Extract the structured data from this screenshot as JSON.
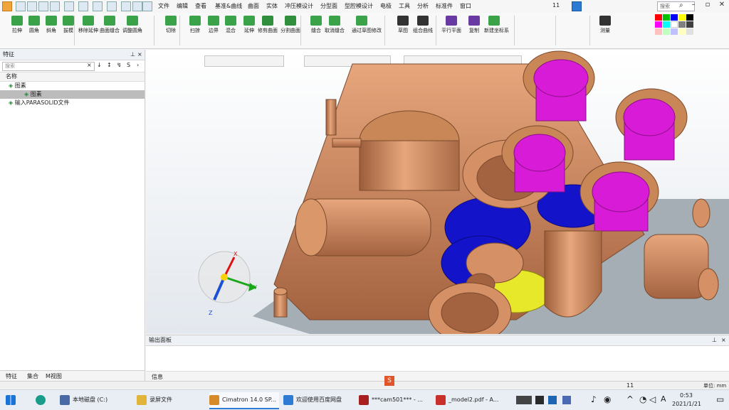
{
  "titlebar": {
    "menu": [
      "文件",
      "编辑",
      "查看",
      "基准&曲线",
      "曲面",
      "实体",
      "冲压模设计",
      "分型面",
      "型腔模设计",
      "电极",
      "工具",
      "分析",
      "标准件",
      "窗口"
    ],
    "page_indicator": "11",
    "search_placeholder": "搜索"
  },
  "ribbon": {
    "buttons": [
      {
        "label": "拉伸",
        "color": "#3aa34a"
      },
      {
        "label": "圆角",
        "color": "#3aa34a"
      },
      {
        "label": "斜角",
        "color": "#3aa34a"
      },
      {
        "label": "拔模",
        "color": "#3aa34a"
      },
      {
        "label": "移除延伸",
        "color": "#3aa34a"
      },
      {
        "label": "曲面缝合",
        "color": "#3aa34a"
      },
      {
        "label": "调整圆角",
        "color": "#3aa34a"
      },
      {
        "label": "切除",
        "color": "#3aa34a"
      },
      {
        "label": "扫掠",
        "color": "#3aa34a"
      },
      {
        "label": "边界",
        "color": "#3aa34a"
      },
      {
        "label": "混合",
        "color": "#3aa34a"
      },
      {
        "label": "延伸",
        "color": "#3aa34a"
      },
      {
        "label": "修剪曲面",
        "color": "#2f8f3c"
      },
      {
        "label": "分割曲面",
        "color": "#2f8f3c"
      },
      {
        "label": "缝合",
        "color": "#3aa34a"
      },
      {
        "label": "取消缝合",
        "color": "#3aa34a"
      },
      {
        "label": "通过草图修改",
        "color": "#3aa34a"
      },
      {
        "label": "草图",
        "color": "#333333"
      },
      {
        "label": "组合曲线",
        "color": "#333333"
      },
      {
        "label": "平行平面",
        "color": "#6a3aa3"
      },
      {
        "label": "复制",
        "color": "#6a3aa3"
      },
      {
        "label": "新建坐标系",
        "color": "#3aa34a"
      },
      {
        "label": "测量",
        "color": "#333333"
      }
    ]
  },
  "leftpanel": {
    "title": "特征",
    "filter_placeholder": "搜索",
    "column_header": "名称",
    "tree": [
      {
        "label": "图素",
        "level": 0
      },
      {
        "label": "图素",
        "level": 1,
        "selected": true
      },
      {
        "label": "输入PARASOLID文件",
        "level": 0
      }
    ],
    "tabs": [
      "特征",
      "集合",
      "M视图"
    ]
  },
  "viewport": {
    "axis_labels": {
      "x": "X",
      "y": "Y",
      "z": "Z"
    }
  },
  "output": {
    "title": "输出面板",
    "tab": "信息"
  },
  "status": {
    "page": "11",
    "unit": "单位: mm"
  },
  "taskbar": {
    "apps": [
      {
        "label": "本地磁盘 (C:)",
        "color": "#4a6aa5"
      },
      {
        "label": "录屏文件",
        "color": "#e0b53a"
      },
      {
        "label": "Cimatron 14.0 SP...",
        "color": "#d78a2a",
        "active": true
      },
      {
        "label": "欢迎使用百度网盘",
        "color": "#2e7bd3"
      },
      {
        "label": "***cam501*** - ...",
        "color": "#a81f1f"
      },
      {
        "label": "_model2.pdf - A...",
        "color": "#c9302c"
      }
    ],
    "time": "0:53",
    "date": "2021/1/21"
  },
  "colors": {
    "copper": "#c8845a",
    "magenta": "#d81bd6",
    "blue": "#1313c9",
    "yellow": "#e8e82a"
  }
}
